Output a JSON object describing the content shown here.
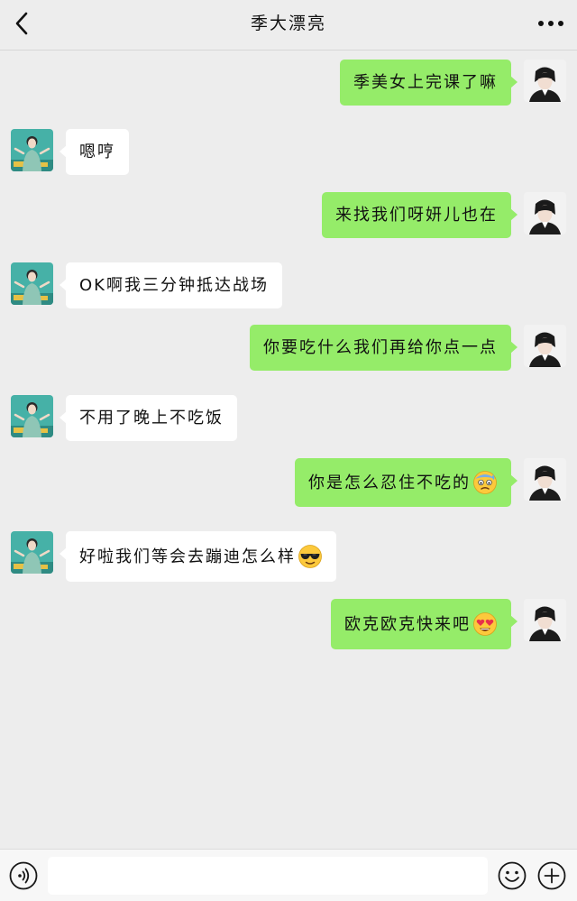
{
  "header": {
    "title": "季大漂亮",
    "back_icon": "chevron-left-icon",
    "more_icon": "more-dots-icon"
  },
  "colors": {
    "background": "#ededed",
    "sent_bubble": "#95ec69",
    "received_bubble": "#ffffff"
  },
  "messages": [
    {
      "side": "right",
      "text": "季美女上完课了嘛",
      "emoji": ""
    },
    {
      "side": "left",
      "text": "嗯哼",
      "emoji": ""
    },
    {
      "side": "right",
      "text": "来找我们呀妍儿也在",
      "emoji": ""
    },
    {
      "side": "left",
      "text": "OK啊我三分钟抵达战场",
      "emoji": ""
    },
    {
      "side": "right",
      "text": "你要吃什么我们再给你点一点",
      "emoji": ""
    },
    {
      "side": "left",
      "text": "不用了晚上不吃饭",
      "emoji": ""
    },
    {
      "side": "right",
      "text": "你是怎么忍住不吃的",
      "emoji": "anxious-sweat-emoji"
    },
    {
      "side": "left",
      "text": "好啦我们等会去蹦迪怎么样",
      "emoji": "sunglasses-emoji"
    },
    {
      "side": "right",
      "text": "欧克欧克快来吧",
      "emoji": "heart-eyes-emoji"
    }
  ],
  "input_bar": {
    "voice_icon": "voice-icon",
    "emoji_icon": "emoji-smile-icon",
    "plus_icon": "plus-icon",
    "input_value": ""
  }
}
